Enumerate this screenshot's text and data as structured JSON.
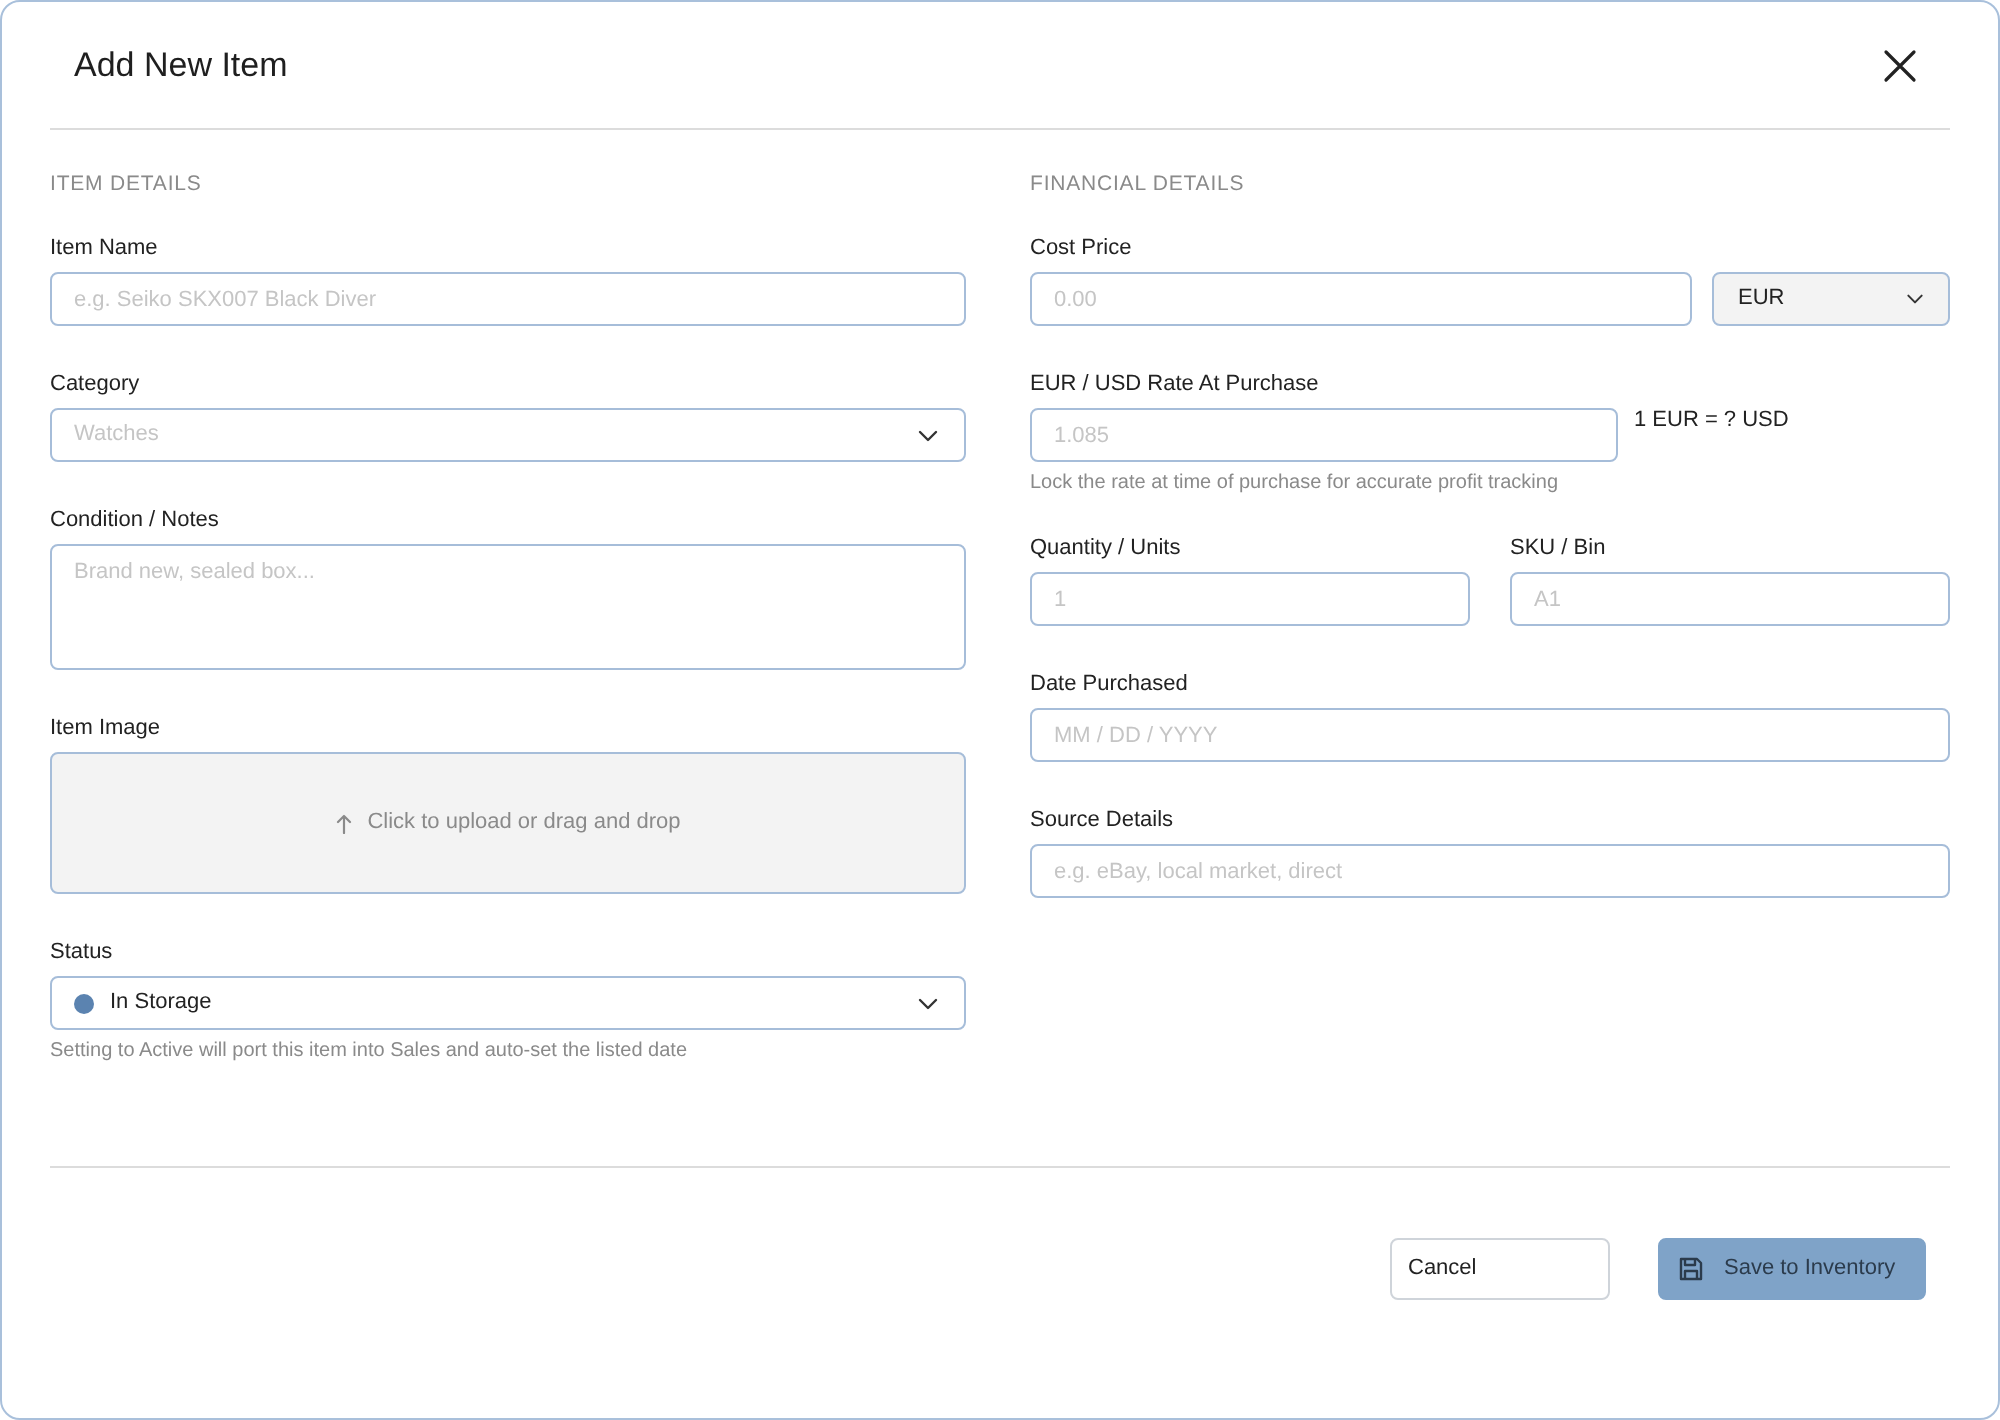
{
  "dialog": {
    "title": "Add New Item"
  },
  "sections": [
    {
      "heading": "ITEM DETAILS",
      "fields": [
        {
          "kind": "text",
          "label": "Item Name",
          "placeholder": "e.g. Seiko SKX007 Black Diver"
        },
        {
          "kind": "select",
          "label": "Category",
          "placeholder": "Watches"
        },
        {
          "kind": "textarea",
          "label": "Condition / Notes",
          "placeholder": "Brand new, sealed box..."
        },
        {
          "kind": "upload",
          "label": "Item Image",
          "prompt": "Click to upload or drag and drop"
        },
        {
          "kind": "status",
          "label": "Status",
          "value": "In Storage",
          "color": "#5b83b0",
          "help": "Setting to Active will port this item into Sales and auto-set the listed date"
        }
      ]
    },
    {
      "heading": "FINANCIAL DETAILS",
      "fields": [
        {
          "kind": "price",
          "label": "Cost Price",
          "placeholder": "0.00",
          "currency": "EUR"
        },
        {
          "kind": "rate",
          "label": "EUR / USD Rate At Purchase",
          "placeholder": "1.085",
          "suffix": "1 EUR = ? USD",
          "help": "Lock the rate at time of purchase for accurate profit tracking"
        },
        {
          "kind": "pair",
          "fields": [
            {
              "label": "Quantity / Units",
              "placeholder": "1"
            },
            {
              "label": "SKU / Bin",
              "placeholder": "A1"
            }
          ]
        },
        {
          "kind": "text",
          "label": "Date Purchased",
          "placeholder": "MM / DD / YYYY"
        },
        {
          "kind": "text",
          "label": "Source Details",
          "placeholder": "e.g. eBay, local market, direct"
        }
      ]
    }
  ],
  "buttons": [
    {
      "kind": "secondary",
      "label": "Cancel"
    },
    {
      "kind": "primary",
      "label": "Save to Inventory"
    }
  ]
}
